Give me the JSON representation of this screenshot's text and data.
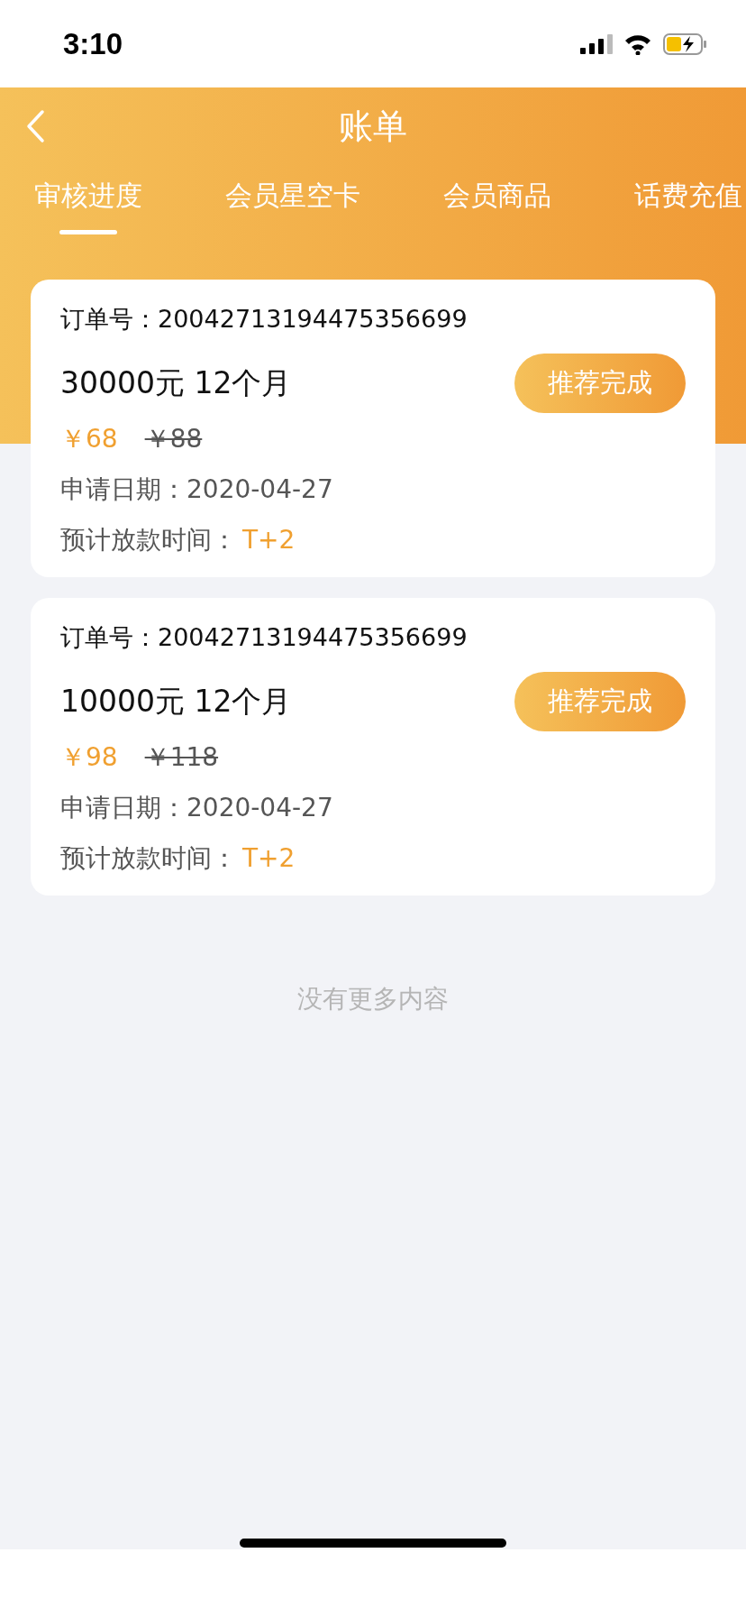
{
  "status_bar": {
    "time": "3:10"
  },
  "header": {
    "title": "账单"
  },
  "tabs": [
    {
      "label": "审核进度",
      "selected": true
    },
    {
      "label": "会员星空卡",
      "selected": false
    },
    {
      "label": "会员商品",
      "selected": false
    },
    {
      "label": "话费充值",
      "selected": false
    }
  ],
  "orders": [
    {
      "order_label": "订单号：",
      "order_no": "20042713194475356699",
      "plan": "30000元 12个月",
      "button": "推荐完成",
      "price": "￥68",
      "original_price": "￥88",
      "date_label": "申请日期：",
      "date": "2020-04-27",
      "payout_label": "预计放款时间：",
      "payout": "T+2"
    },
    {
      "order_label": "订单号：",
      "order_no": "20042713194475356699",
      "plan": "10000元 12个月",
      "button": "推荐完成",
      "price": "￥98",
      "original_price": "￥118",
      "date_label": "申请日期：",
      "date": "2020-04-27",
      "payout_label": "预计放款时间：",
      "payout": "T+2"
    }
  ],
  "footer_note": "没有更多内容"
}
